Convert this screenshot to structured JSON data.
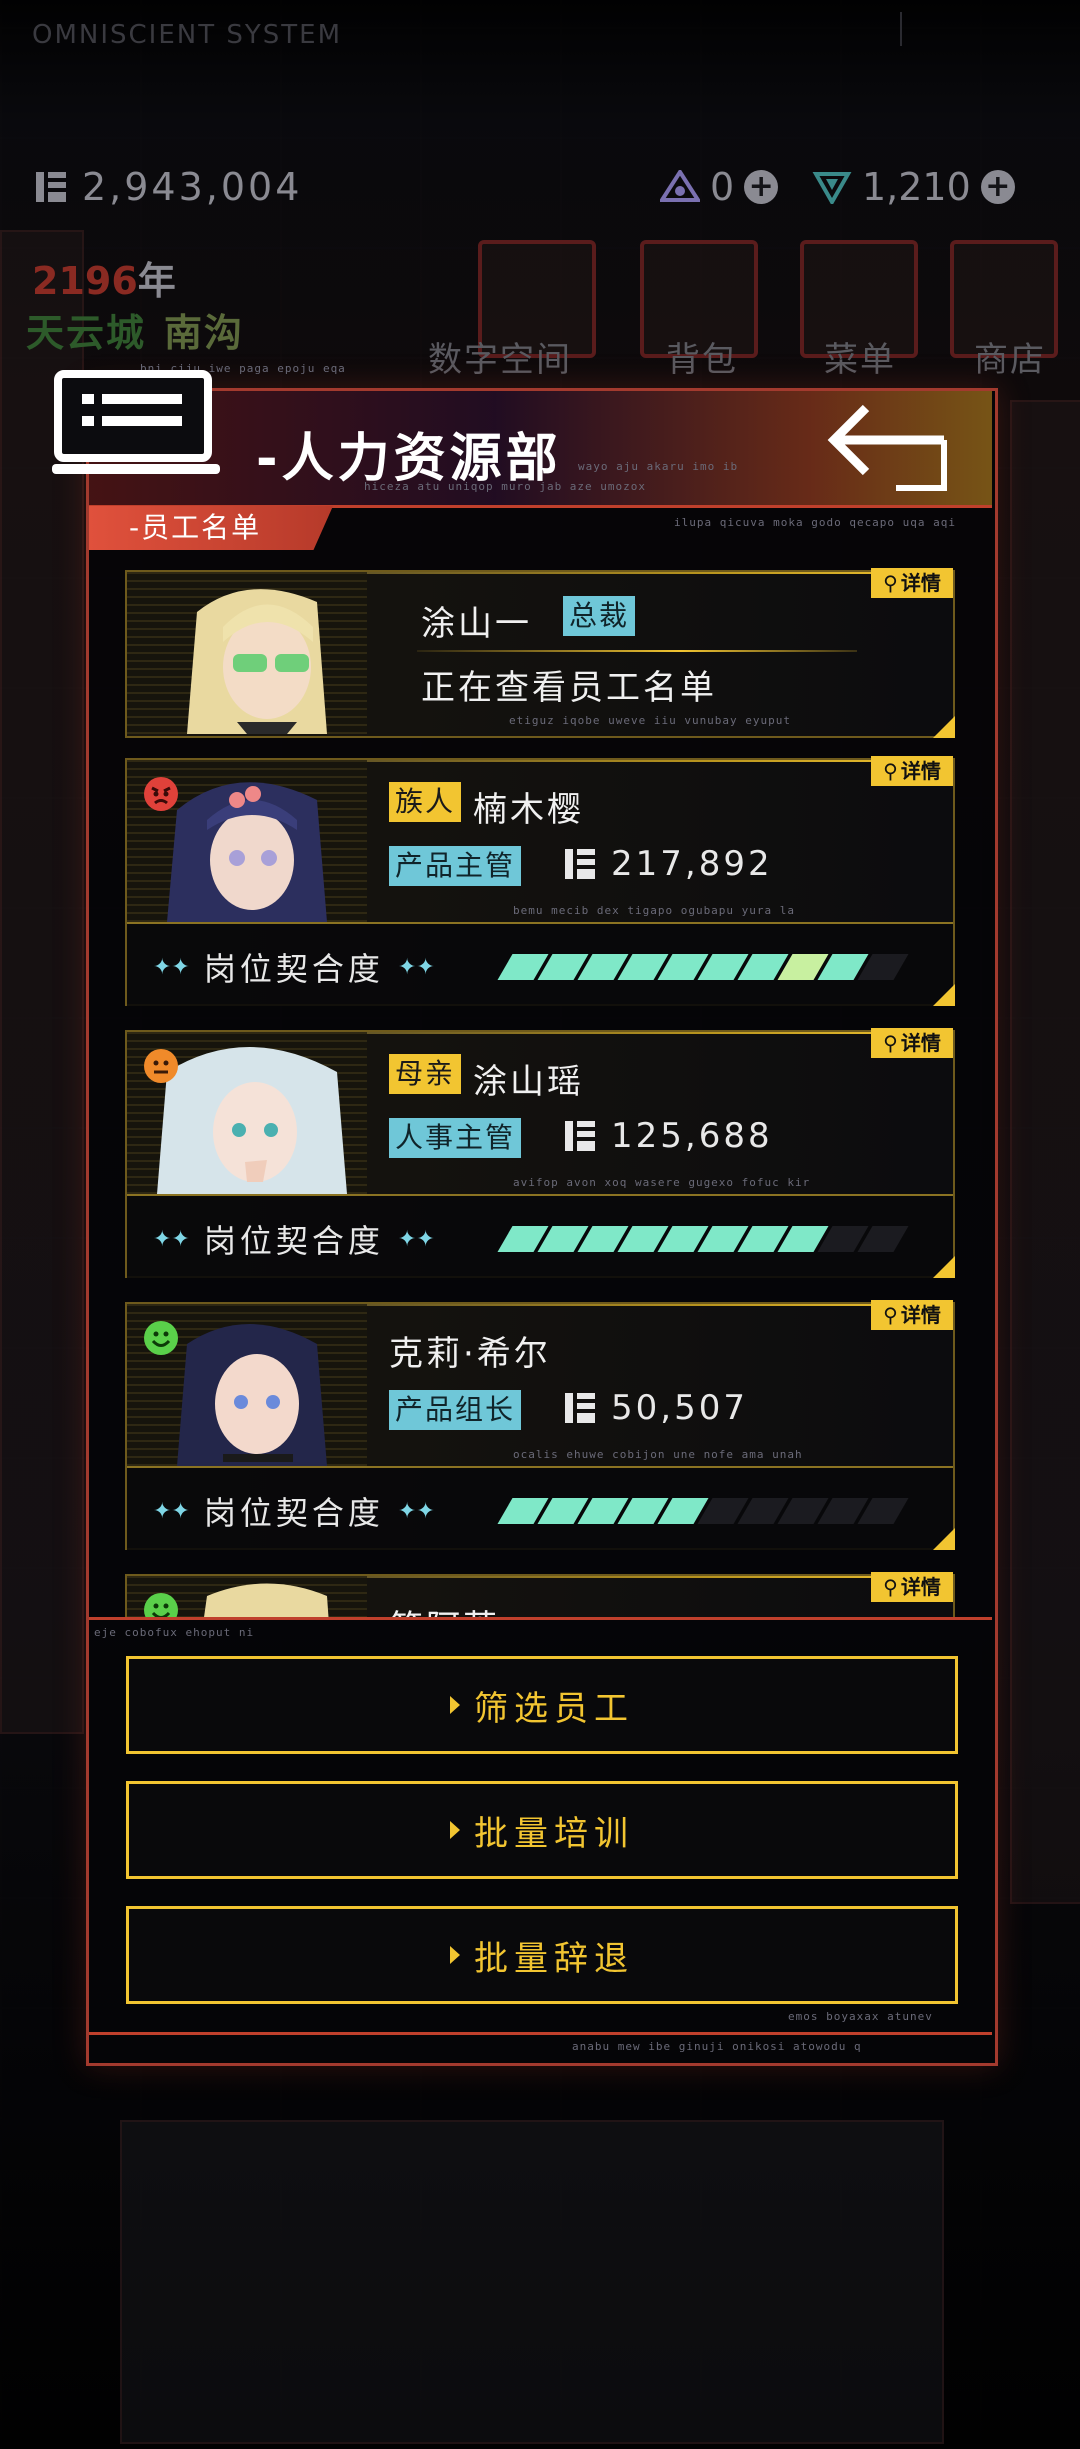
{
  "system": {
    "name": "OMNISCIENT SYSTEM",
    "subtitle": ""
  },
  "currencies": {
    "money": "2,943,004",
    "resource_a": "0",
    "resource_b": "1,210"
  },
  "date": {
    "year": "2196",
    "year_suffix": "年"
  },
  "location": {
    "city": "天云城",
    "district": "南沟"
  },
  "nav": [
    {
      "label": "数字空间",
      "icon": "cube-icon"
    },
    {
      "label": "背包",
      "icon": "backpack-icon"
    },
    {
      "label": "菜单",
      "icon": "menu-icon"
    },
    {
      "label": "商店",
      "icon": "cart-icon"
    }
  ],
  "panel": {
    "title": "-人力资源部",
    "flavor_top": "bni ciju iwe paga epoju eqa",
    "flavor_right": "wayo aju akaru imo ib",
    "flavor_under": "hiceza atu uniqop muro jab aze umozox",
    "flavor_tab": "ilupa qicuva moka godo qecapo uqa aqi",
    "tab_label": "-员工名单"
  },
  "detail_label": "详情",
  "fit_label": "岗位契合度",
  "employees": [
    {
      "name": "涂山一",
      "title_tag": "总裁",
      "status": "正在查看员工名单",
      "flavor": "etiguz iqobe uweve iiu vunubay eyuput",
      "mood_icon": "",
      "fit": null
    },
    {
      "name": "楠木樱",
      "relation_tag": "族人",
      "title_tag": "产品主管",
      "salary": "217,892",
      "flavor": "bemu mecib dex tigapo ogubapu yura la",
      "mood_icon": "angry-face-icon",
      "fit": 0.88
    },
    {
      "name": "涂山瑶",
      "relation_tag": "母亲",
      "title_tag": "人事主管",
      "salary": "125,688",
      "flavor": "avifop avon xoq wasere gugexo fofuc kir",
      "mood_icon": "neutral-face-icon",
      "fit": 0.8
    },
    {
      "name": "克莉·希尔",
      "title_tag": "产品组长",
      "salary": "50,507",
      "flavor": "ocalis ehuwe cobijon une nofe ama unah",
      "mood_icon": "happy-face-icon",
      "fit": 0.45
    },
    {
      "name": "笹阿莱",
      "mood_icon": "happy-face-icon"
    }
  ],
  "list_footer_flavor": "eje cobofux ehoput ni",
  "actions": [
    {
      "label": "筛选员工"
    },
    {
      "label": "批量培训"
    },
    {
      "label": "批量辞退"
    }
  ],
  "actions_flavor": "emos boyaxax atunev",
  "panel_footer_flavor": "anabu mew ibe ginuji onikosi atowodu q",
  "colors": {
    "accent_gold": "#f2c531",
    "accent_red": "#c0402c",
    "tag_blue": "#6fc7d8",
    "fit_bar": "#7fe8c8"
  }
}
